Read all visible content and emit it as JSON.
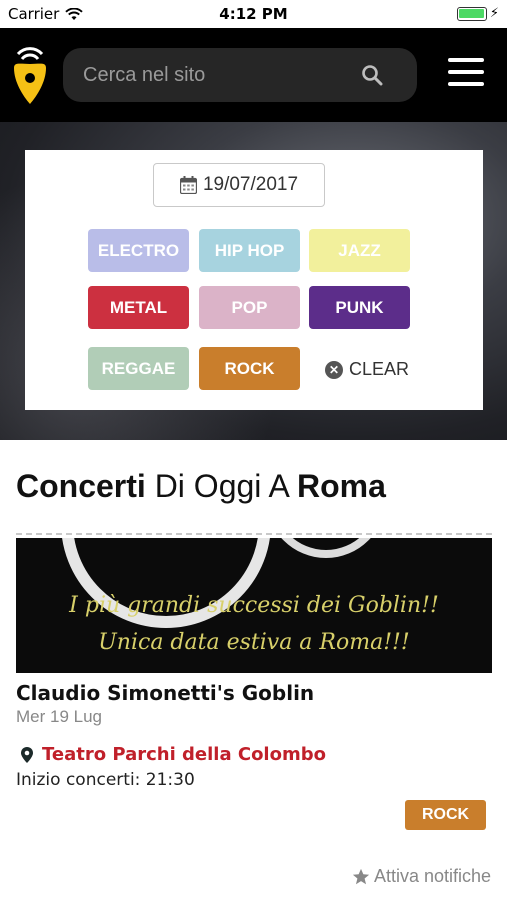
{
  "status_bar": {
    "carrier": "Carrier",
    "time": "4:12 PM"
  },
  "header": {
    "search_placeholder": "Cerca nel sito"
  },
  "filters": {
    "date": "19/07/2017",
    "tags": [
      {
        "label": "ELECTRO",
        "color": "#b9bde8"
      },
      {
        "label": "HIP HOP",
        "color": "#a7d3df"
      },
      {
        "label": "JAZZ",
        "color": "#f2f09c"
      },
      {
        "label": "METAL",
        "color": "#cc3040"
      },
      {
        "label": "POP",
        "color": "#dbb3c8"
      },
      {
        "label": "PUNK",
        "color": "#5c2d8a"
      },
      {
        "label": "REGGAE",
        "color": "#b1cdb7"
      },
      {
        "label": "ROCK",
        "color": "#c97e2c"
      }
    ],
    "clear_label": "CLEAR"
  },
  "section": {
    "title_bold_1": "Concerti",
    "title_regular": " Di Oggi A ",
    "title_bold_2": "Roma"
  },
  "event": {
    "banner_line1": "I più grandi successi dei Goblin!!",
    "banner_line2": "Unica data estiva a Roma!!!",
    "title": "Claudio Simonetti's Goblin",
    "date": "Mer 19 Lug",
    "venue": "Teatro Parchi della Colombo",
    "start_time": "Inizio concerti: 21:30",
    "tag": "ROCK",
    "notify": "Attiva notifiche"
  }
}
